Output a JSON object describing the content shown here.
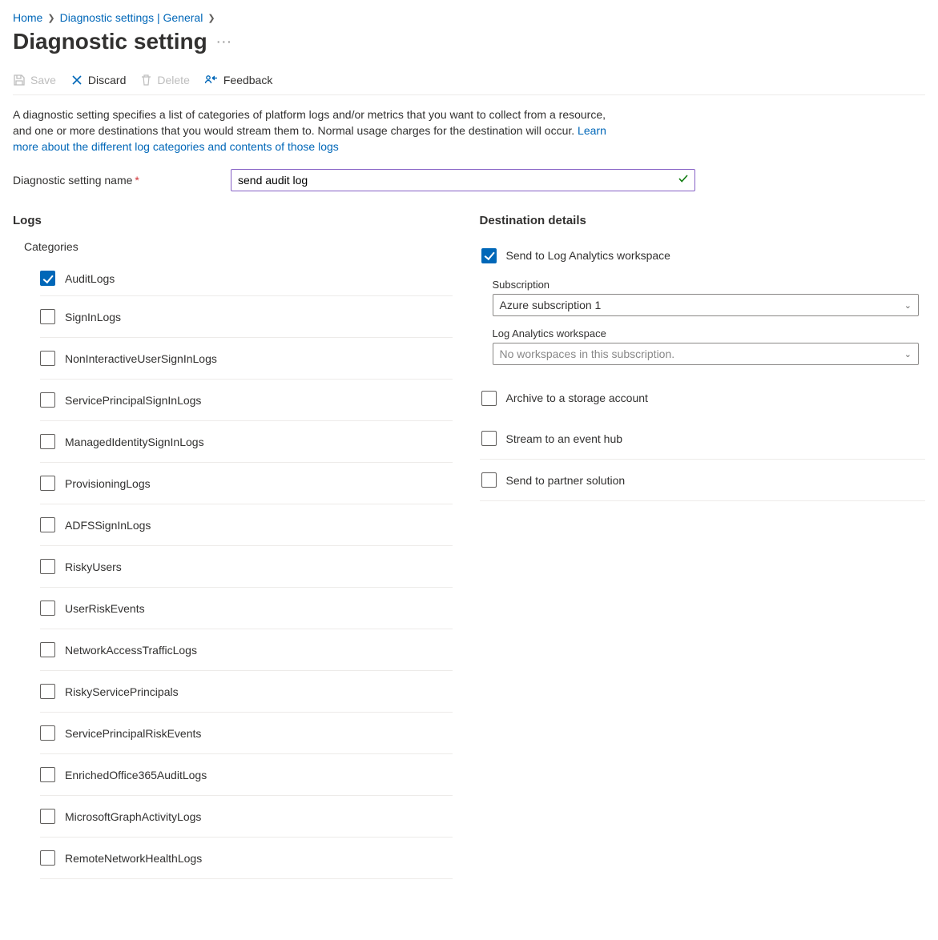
{
  "breadcrumb": {
    "home": "Home",
    "parent": "Diagnostic settings | General"
  },
  "page_title": "Diagnostic setting",
  "toolbar": {
    "save": "Save",
    "discard": "Discard",
    "delete": "Delete",
    "feedback": "Feedback"
  },
  "intro": {
    "text1": "A diagnostic setting specifies a list of categories of platform logs and/or metrics that you want to collect from a resource, and one or more destinations that you would stream them to. Normal usage charges for the destination will occur. ",
    "link": "Learn more about the different log categories and contents of those logs"
  },
  "name_field": {
    "label": "Diagnostic setting name",
    "value": "send audit log"
  },
  "logs": {
    "heading": "Logs",
    "subheading": "Categories",
    "items": [
      {
        "label": "AuditLogs",
        "checked": true
      },
      {
        "label": "SignInLogs",
        "checked": false
      },
      {
        "label": "NonInteractiveUserSignInLogs",
        "checked": false
      },
      {
        "label": "ServicePrincipalSignInLogs",
        "checked": false
      },
      {
        "label": "ManagedIdentitySignInLogs",
        "checked": false
      },
      {
        "label": "ProvisioningLogs",
        "checked": false
      },
      {
        "label": "ADFSSignInLogs",
        "checked": false
      },
      {
        "label": "RiskyUsers",
        "checked": false
      },
      {
        "label": "UserRiskEvents",
        "checked": false
      },
      {
        "label": "NetworkAccessTrafficLogs",
        "checked": false
      },
      {
        "label": "RiskyServicePrincipals",
        "checked": false
      },
      {
        "label": "ServicePrincipalRiskEvents",
        "checked": false
      },
      {
        "label": "EnrichedOffice365AuditLogs",
        "checked": false
      },
      {
        "label": "MicrosoftGraphActivityLogs",
        "checked": false
      },
      {
        "label": "RemoteNetworkHealthLogs",
        "checked": false
      }
    ]
  },
  "dest": {
    "heading": "Destination details",
    "la": {
      "label": "Send to Log Analytics workspace",
      "checked": true,
      "sub_label": "Subscription",
      "sub_value": "Azure subscription 1",
      "ws_label": "Log Analytics workspace",
      "ws_placeholder": "No workspaces in this subscription."
    },
    "others": [
      {
        "label": "Archive to a storage account",
        "checked": false
      },
      {
        "label": "Stream to an event hub",
        "checked": false
      },
      {
        "label": "Send to partner solution",
        "checked": false
      }
    ]
  }
}
